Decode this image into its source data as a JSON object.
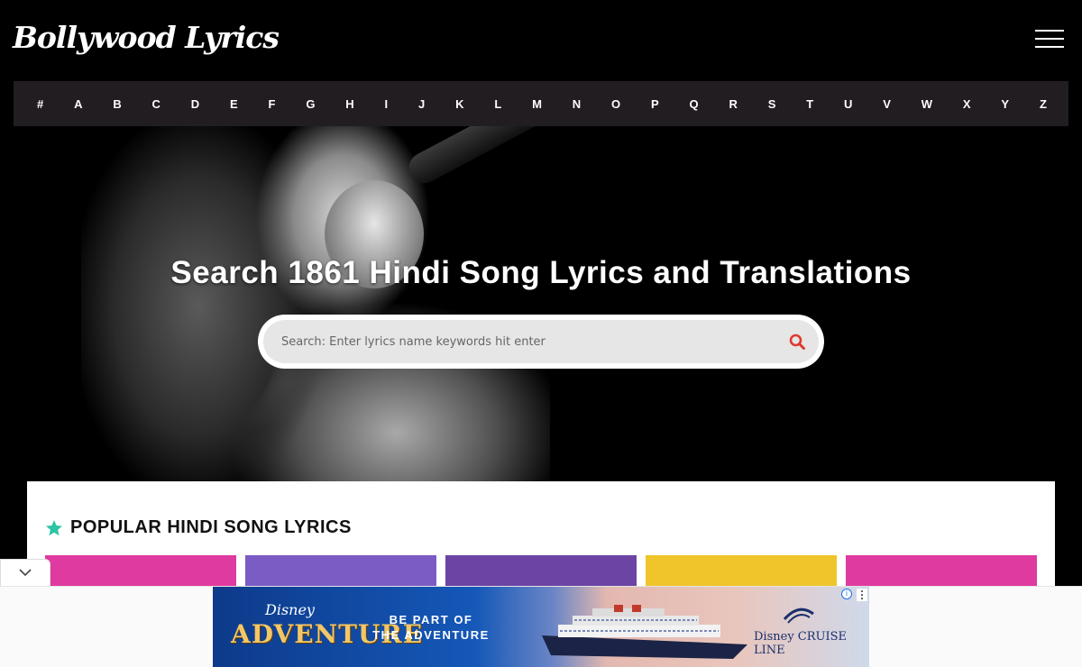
{
  "header": {
    "logo_text": "Bollywood Lyrics",
    "menu_icon": "hamburger-menu-icon"
  },
  "alphabet_nav": [
    "#",
    "A",
    "B",
    "C",
    "D",
    "E",
    "F",
    "G",
    "H",
    "I",
    "J",
    "K",
    "L",
    "M",
    "N",
    "O",
    "P",
    "Q",
    "R",
    "S",
    "T",
    "U",
    "V",
    "W",
    "X",
    "Y",
    "Z"
  ],
  "hero": {
    "title": "Search 1861 Hindi Song Lyrics and Translations",
    "search_placeholder": "Search: Enter lyrics name keywords hit enter",
    "search_icon": "search-icon"
  },
  "popular": {
    "icon": "star-icon",
    "title": "POPULAR HINDI SONG LYRICS",
    "tile_colors": [
      "#df3a9f",
      "#7b5cc4",
      "#6c44a4",
      "#efc52b",
      "#df3a9f"
    ]
  },
  "ad": {
    "brand_small": "Disney",
    "headline": "ADVENTURE",
    "cta_line1": "BE PART OF",
    "cta_line2": "THE ADVENTURE",
    "cruise_line": "Disney CRUISE LINE",
    "info_icon": "info-icon",
    "more_icon": "more-vertical-icon"
  },
  "colors": {
    "accent_star": "#2bc4a4",
    "search_icon": "#e03a2f",
    "nav_bg": "#221d21"
  }
}
